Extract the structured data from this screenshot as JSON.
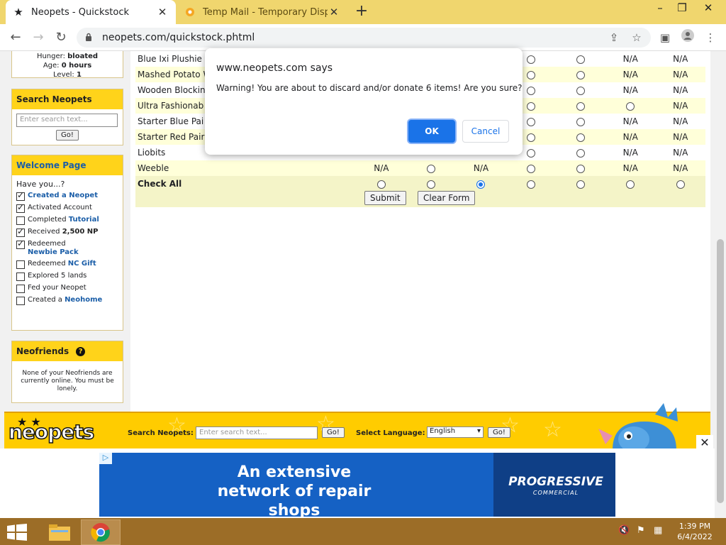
{
  "browser": {
    "tabs": [
      {
        "title": "Neopets - Quickstock",
        "active": true
      },
      {
        "title": "Temp Mail - Temporary Disposa",
        "active": false
      }
    ],
    "url": "neopets.com/quickstock.phtml"
  },
  "sidebar": {
    "pet_stats": {
      "hunger_label": "Hunger:",
      "hunger": "bloated",
      "age_label": "Age:",
      "age": "0 hours",
      "level_label": "Level:",
      "level": "1"
    },
    "search": {
      "title": "Search Neopets",
      "placeholder": "Enter search text...",
      "button": "Go!"
    },
    "welcome": {
      "title": "Welcome Page",
      "intro": "Have you...?",
      "items": [
        {
          "text": "",
          "link": "Created a Neopet",
          "checked": true
        },
        {
          "text": "Activated Account",
          "link": "",
          "checked": true
        },
        {
          "text": "Completed ",
          "link": "Tutorial",
          "checked": false
        },
        {
          "text": "Received ",
          "link": "2,500 NP",
          "checked": true
        },
        {
          "text": "Redeemed",
          "link": "Newbie Pack",
          "checked": true
        },
        {
          "text": "Redeemed ",
          "link": "NC Gift",
          "checked": false
        },
        {
          "text": "Explored 5 lands",
          "link": "",
          "checked": false
        },
        {
          "text": "Fed your Neopet",
          "link": "",
          "checked": false
        },
        {
          "text": "Created a ",
          "link": "Neohome",
          "checked": false
        }
      ]
    },
    "neofriends": {
      "title": "Neofriends",
      "help_icon": "question-circle-icon",
      "message": "None of your Neofriends are currently online. You must be lonely."
    }
  },
  "quickstock": {
    "rows": [
      {
        "name": "Blue Ixi Plushie",
        "cells": [
          "",
          "",
          "",
          "radio",
          "radio",
          "N/A",
          "N/A"
        ]
      },
      {
        "name": "Mashed Potato W",
        "cells": [
          "",
          "",
          "",
          "radio",
          "radio",
          "N/A",
          "N/A"
        ]
      },
      {
        "name": "Wooden Blockin",
        "cells": [
          "",
          "",
          "",
          "radio",
          "radio",
          "N/A",
          "N/A"
        ]
      },
      {
        "name": "Ultra Fashionab",
        "cells": [
          "",
          "",
          "",
          "radio",
          "radio",
          "radio",
          "N/A"
        ]
      },
      {
        "name": "Starter Blue Pai",
        "cells": [
          "",
          "",
          "",
          "radio",
          "radio",
          "N/A",
          "N/A"
        ]
      },
      {
        "name": "Starter Red Pair",
        "cells": [
          "",
          "",
          "",
          "radio",
          "radio",
          "N/A",
          "N/A"
        ]
      },
      {
        "name": "Liobits",
        "cells": [
          "",
          "",
          "",
          "radio",
          "radio",
          "N/A",
          "N/A"
        ]
      },
      {
        "name": "Weeble",
        "cells": [
          "N/A",
          "radio",
          "N/A",
          "radio",
          "radio",
          "N/A",
          "N/A"
        ]
      }
    ],
    "check_all": {
      "label": "Check All",
      "selected_index": 2
    },
    "submit": "Submit",
    "clear": "Clear Form"
  },
  "footer": {
    "logo": "neopets",
    "search_label": "Search Neopets:",
    "search_placeholder": "Enter search text...",
    "go": "Go!",
    "language_label": "Select Language:",
    "language": "English",
    "go2": "Go!"
  },
  "ad": {
    "headline": "An extensive network of repair shops",
    "brand": "PROGRESSIVE",
    "brand_sub": "COMMERCIAL",
    "close": "✕"
  },
  "dialog": {
    "origin": "www.neopets.com says",
    "message": "Warning! You are about to discard and/or donate 6 items! Are you sure?",
    "ok": "OK",
    "cancel": "Cancel"
  },
  "taskbar": {
    "time": "1:39 PM",
    "date": "6/4/2022"
  },
  "colors": {
    "tabstrip": "#f0d66e",
    "sidebar_header": "#ffd31a",
    "footer": "#ffcc00",
    "dialog_primary": "#1a73e8",
    "taskbar": "#9c6d27",
    "ad_blue": "#1561c4"
  }
}
